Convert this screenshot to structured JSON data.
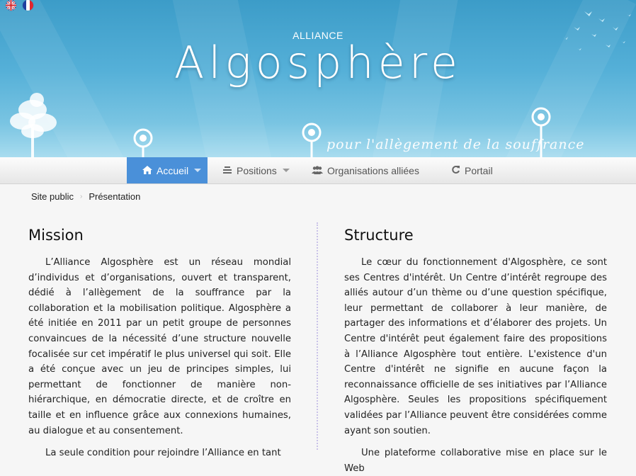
{
  "languages": [
    {
      "name": "english-flag-icon",
      "label": "English"
    },
    {
      "name": "french-flag-icon",
      "label": "Français"
    }
  ],
  "header": {
    "subtitle": "ALLIANCE",
    "title": "Algosphère",
    "tagline": "pour l'allègement de la souffrance"
  },
  "nav": {
    "items": [
      {
        "label": "Accueil",
        "icon": "home-icon",
        "active": true,
        "dropdown": true
      },
      {
        "label": "Positions",
        "icon": "list-icon",
        "active": false,
        "dropdown": true
      },
      {
        "label": "Organisations alliées",
        "icon": "users-icon",
        "active": false,
        "dropdown": false
      },
      {
        "label": "Portail",
        "icon": "refresh-icon",
        "active": false,
        "dropdown": false
      }
    ]
  },
  "breadcrumb": [
    "Site public",
    "Présentation"
  ],
  "mission": {
    "title": "Mission",
    "paragraphs": [
      "L’Alliance Algosphère est un réseau mondial d’individus et d’organisations, ouvert et transparent, dédié à l’allègement de la souffrance par la collaboration et la mobilisation politique. Algosphère a été initiée en 2011 par un petit groupe de personnes convaincues de la nécessité d’une structure nouvelle focalisée sur cet impératif le plus universel qui soit. Elle a été conçue avec un jeu de principes simples, lui permettant de fonctionner de manière non-hiérarchique, en démocratie directe, et de croître en taille et en influence grâce aux connexions humaines, au dialogue et au consentement.",
      "La seule condition pour rejoindre l’Alliance en tant"
    ]
  },
  "structure": {
    "title": "Structure",
    "paragraphs": [
      "Le cœur du fonctionnement d'Algosphère, ce sont ses Centres d'intérêt. Un Centre d’intérêt regroupe des alliés autour d’un thème ou d’une question spécifique, leur permettant de collaborer à leur manière, de partager des informations et d’élaborer des projets. Un Centre d'intérêt peut également faire des propositions à l’Alliance Algosphère tout entière. L'existence d'un Centre d'intérêt ne signifie en aucune façon la reconnaissance officielle de ses initiatives par l’Alliance Algosphère. Seules les propositions spécifiquement validées par l’Alliance peuvent être considérées comme ayant son soutien.",
      "Une plateforme collaborative mise en place sur le Web"
    ]
  },
  "colors": {
    "banner_top": "#3c9cc8",
    "banner_bottom": "#a8dcef",
    "nav_active": "#4a90d9",
    "divider": "#c9c2e8"
  }
}
